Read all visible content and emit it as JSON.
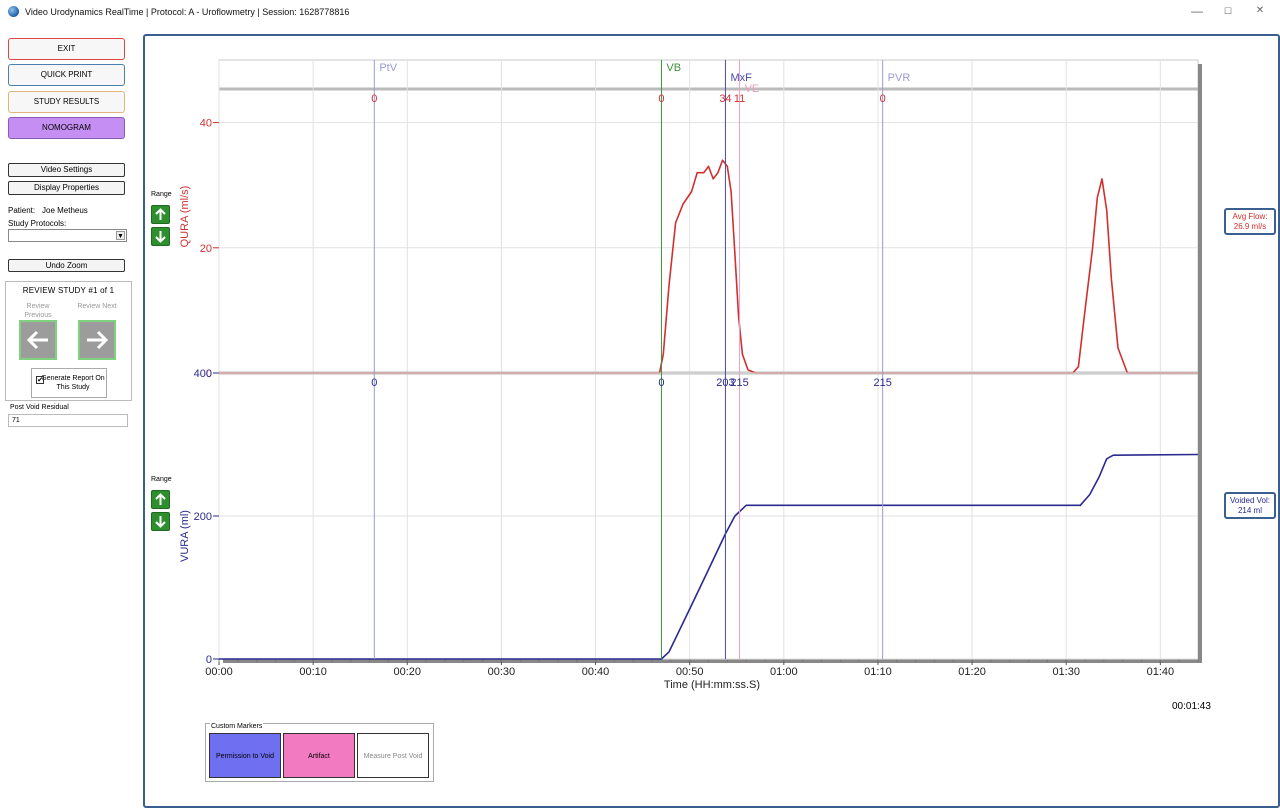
{
  "window": {
    "title": "Video Urodynamics RealTime | Protocol: A - Uroflowmetry | Session: 1628778816",
    "minimize": "—",
    "maximize": "☐",
    "close": "✕"
  },
  "sidebar": {
    "exit_label": "EXIT",
    "quick_print_label": "QUICK PRINT",
    "study_results_label": "STUDY RESULTS",
    "nomogram_label": "NOMOGRAM",
    "video_settings_label": "Video Settings",
    "display_properties_label": "Display Properties",
    "patient_label": "Patient:",
    "patient_name": "Joe Metheus",
    "study_protocols_label": "Study Protocols:",
    "study_protocols_value": "",
    "undo_zoom_label": "Undo Zoom",
    "review": {
      "heading": "REVIEW STUDY #1 of 1",
      "previous_label": "Review Previous",
      "next_label": "Review Next"
    },
    "generate_report_label": "Generate Report On This Study",
    "generate_report_checked": "✔",
    "post_void_residual_label": "Post Void Residual",
    "post_void_residual_value": "71"
  },
  "graph": {
    "range_label": "Range",
    "avg_flow_box": {
      "label": "Avg Flow:",
      "value": "26.9 ml/s"
    },
    "voided_vol_box": {
      "label": "Voided Vol:",
      "value": "214 ml"
    },
    "time_readout": "00:01:43",
    "xlabel": "Time (HH:mm:ss.S)",
    "flow_axis_label": "QURA (ml/s)",
    "volume_axis_label": "VURA (ml)",
    "colors": {
      "flow": "#d03030",
      "volume": "#2a2a90",
      "frame": "#3a5f8e"
    }
  },
  "custom_markers": {
    "title": "Custom Markers",
    "permission_to_void": "Permission to Void",
    "artifact": "Artifact",
    "measure_post_void": "Measure Post Void",
    "colors": {
      "permission": "#6f6ff2",
      "artifact": "#f27ac0",
      "measure": "#ffffff"
    }
  },
  "chart_data": {
    "type": "line",
    "xlabel": "Time (HH:mm:ss.S)",
    "x_ticks": [
      "00:00",
      "00:10",
      "00:20",
      "00:30",
      "00:40",
      "00:50",
      "01:00",
      "01:10",
      "01:20",
      "01:30",
      "01:40"
    ],
    "xlim_seconds": [
      0,
      104
    ],
    "event_markers": [
      {
        "label": "PtV",
        "t": 16.5,
        "flow_value": "0",
        "volume_value": "0",
        "color": "#9a9ad8"
      },
      {
        "label": "VB",
        "t": 47.0,
        "flow_value": "0",
        "volume_value": "0",
        "color": "#3f8f3f"
      },
      {
        "label": "MxF",
        "t": 53.8,
        "flow_value": "34",
        "volume_value": "203",
        "color": "#4a4aa8"
      },
      {
        "label": "VE",
        "t": 55.3,
        "flow_value": "11",
        "volume_value": "215",
        "color": "#e8a0c0"
      },
      {
        "label": "PVR",
        "t": 70.5,
        "flow_value": "0",
        "volume_value": "215",
        "color": "#9a9ad8"
      }
    ],
    "panels": [
      {
        "name": "QURA (ml/s)",
        "ylim": [
          0,
          50
        ],
        "yticks": [
          0,
          20,
          40
        ],
        "color": "#d03030",
        "series": [
          {
            "x": [
              0,
              46.8,
              47.2,
              47.8,
              48.5,
              49.3,
              50.2,
              50.8,
              51.5,
              52.0,
              52.5,
              53.0,
              53.5,
              54.0,
              54.4,
              54.8,
              55.2,
              55.6,
              56.2,
              57.0,
              90.7,
              91.3,
              92.0,
              92.8,
              93.3,
              93.8,
              94.3,
              94.8,
              95.5,
              96.5,
              104
            ],
            "y": [
              0,
              0,
              3,
              14,
              24,
              27,
              29,
              32,
              32,
              33,
              31,
              32,
              34,
              33,
              29,
              19,
              9,
              3,
              0.5,
              0,
              0,
              1,
              10,
              20,
              28,
              31,
              26,
              15,
              4,
              0,
              0
            ]
          }
        ]
      },
      {
        "name": "VURA (ml)",
        "ylim": [
          0,
          400
        ],
        "yticks": [
          0,
          200,
          400
        ],
        "color": "#2a2a90",
        "series": [
          {
            "x": [
              0,
              47.0,
              47.8,
              50.0,
              52.0,
              53.8,
              54.8,
              56.0,
              90.5,
              91.5,
              92.5,
              93.5,
              94.3,
              95.0,
              104
            ],
            "y": [
              0,
              0,
              10,
              70,
              125,
              175,
              200,
              215,
              215,
              215,
              230,
              255,
              280,
              285,
              286
            ]
          }
        ]
      }
    ]
  }
}
